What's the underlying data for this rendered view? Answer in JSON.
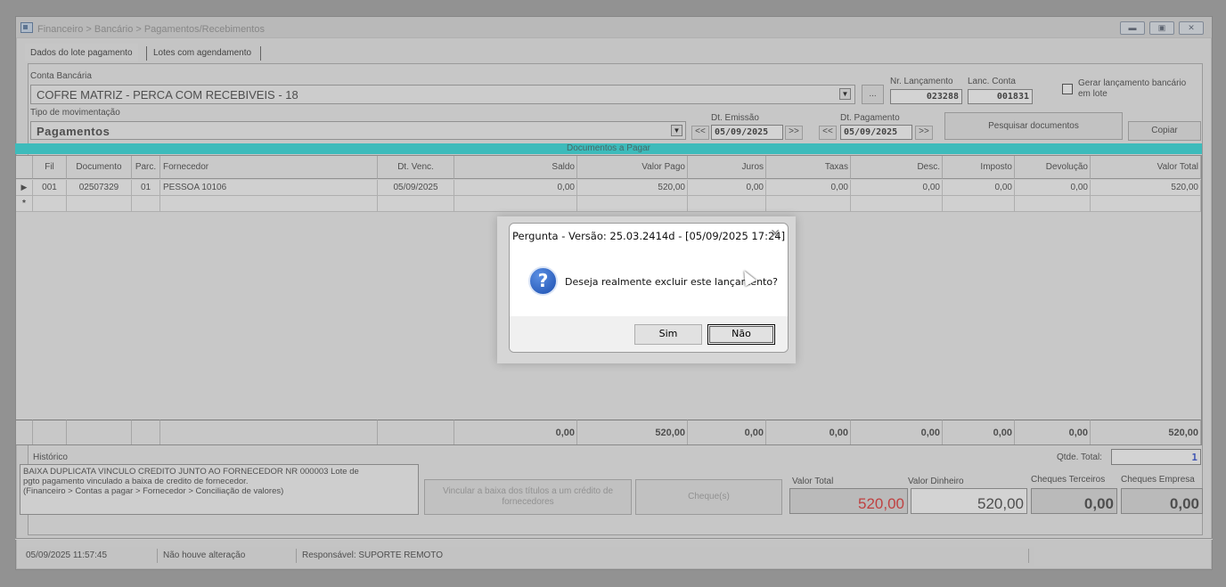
{
  "window": {
    "title": "Financeiro > Bancário > Pagamentos/Recebimentos",
    "tabs": [
      "Dados do lote pagamento",
      "Lotes com agendamento"
    ]
  },
  "form": {
    "conta_label": "Conta Bancária",
    "conta_value": "COFRE MATRIZ - PERCA COM RECEBIVEIS - 18",
    "ellipsis": "...",
    "nr_lancamento_label": "Nr. Lançamento",
    "nr_lancamento_value": "023288",
    "lanc_conta_label": "Lanc. Conta",
    "lanc_conta_value": "001831",
    "gerar_label_1": "Gerar lançamento bancário",
    "gerar_label_2": "em lote",
    "tipo_label": "Tipo de movimentação",
    "tipo_value": "Pagamentos",
    "dt_emissao_label": "Dt. Emissão",
    "dt_emissao_value": "05/09/2025",
    "dt_pagamento_label": "Dt. Pagamento",
    "dt_pagamento_value": "05/09/2025",
    "prev": "<<",
    "next": ">>",
    "pesquisar_label": "Pesquisar documentos",
    "copiar_label": "Copiar"
  },
  "grid": {
    "title": "Documentos a Pagar",
    "columns": [
      "Fil",
      "Documento",
      "Parc.",
      "Fornecedor",
      "Dt. Venc.",
      "Saldo",
      "Valor Pago",
      "Juros",
      "Taxas",
      "Desc.",
      "Imposto",
      "Devolução",
      "Valor Total"
    ],
    "rows": [
      [
        "001",
        "02507329",
        "01",
        "PESSOA 10106",
        "05/09/2025",
        "0,00",
        "520,00",
        "0,00",
        "0,00",
        "0,00",
        "0,00",
        "0,00",
        "520,00"
      ]
    ],
    "new_row_marker": "*",
    "current_row_marker": "▶",
    "totals": [
      "0,00",
      "520,00",
      "0,00",
      "0,00",
      "0,00",
      "0,00",
      "0,00",
      "520,00"
    ]
  },
  "bottom": {
    "historico_label": "Histórico",
    "historico_lines": [
      "BAIXA DUPLICATA VINCULO CREDITO JUNTO AO FORNECEDOR NR 000003 Lote de",
      "pgto pagamento vinculado a baixa de credito de fornecedor.",
      "(Financeiro > Contas a pagar > Fornecedor > Conciliação de valores)"
    ],
    "vincular_label": "Vincular a baixa dos títulos a um crédito de fornecedores",
    "cheques_btn_label": "Cheque(s)",
    "qtde_label": "Qtde. Total:",
    "qtde_value": "1",
    "valor_total_label": "Valor Total",
    "valor_total_value": "520,00",
    "valor_dinheiro_label": "Valor Dinheiro",
    "valor_dinheiro_value": "520,00",
    "cheques_terceiros_label": "Cheques Terceiros",
    "cheques_terceiros_value": "0,00",
    "cheques_empresa_label": "Cheques Empresa",
    "cheques_empresa_value": "0,00"
  },
  "status": {
    "datetime": "05/09/2025 11:57:45",
    "message": "Não houve alteração",
    "responsavel": "Responsável: SUPORTE REMOTO"
  },
  "dialog": {
    "title": "Pergunta - Versão: 25.03.2414d - [05/09/2025 17:24]",
    "message": "Deseja realmente excluir este lançamento?",
    "yes_label": "Sim",
    "no_label": "Não",
    "icon": "question-icon",
    "close_icon": "close-icon"
  },
  "colors": {
    "grid_title_bg": "#19dada",
    "valor_total_text": "#e02020",
    "qtde_text": "#1f3fd0"
  }
}
